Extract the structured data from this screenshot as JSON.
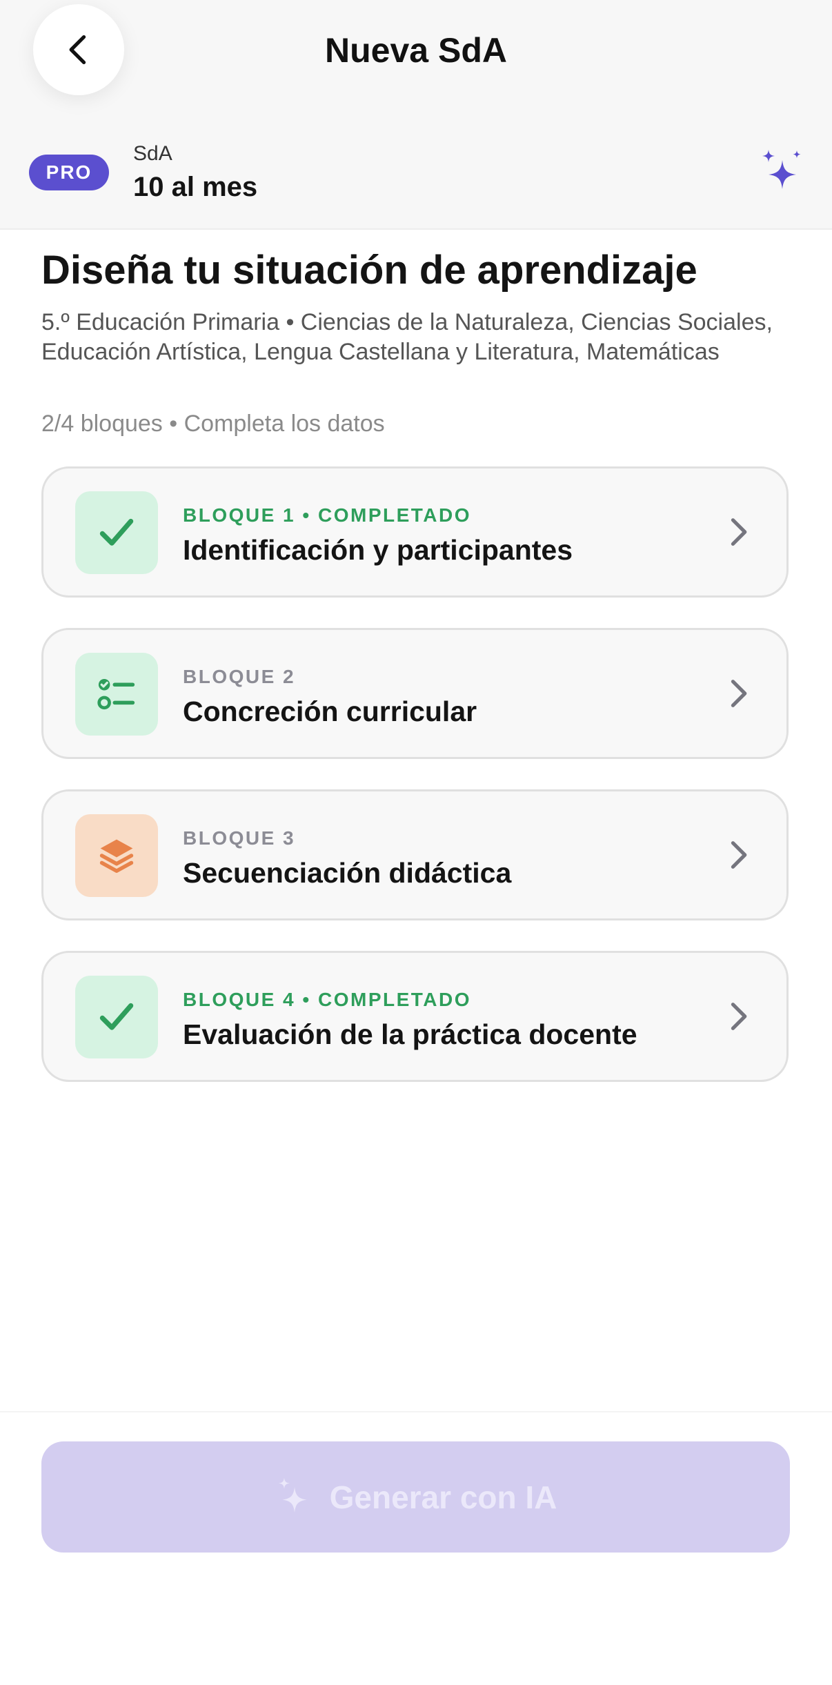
{
  "header": {
    "title": "Nueva SdA",
    "back_icon": "chevron-left-icon"
  },
  "plan": {
    "badge": "PRO",
    "label": "SdA",
    "value": "10 al mes",
    "sparkle_icon": "sparkles-icon"
  },
  "intro": {
    "title": "Diseña tu situación de aprendizaje",
    "subtitle": "5.º Educación Primaria • Ciencias de la Naturaleza, Ciencias Sociales, Educación Artística, Lengua Castellana y Literatura, Matemáticas",
    "progress": "2/4 bloques • Completa los datos"
  },
  "blocks": [
    {
      "eyebrow": "BLOQUE 1 • COMPLETADO",
      "title": "Identificación y participantes",
      "status": "completed",
      "icon": "check-icon"
    },
    {
      "eyebrow": "BLOQUE 2",
      "title": "Concreción curricular",
      "status": "pending",
      "icon": "checklist-icon"
    },
    {
      "eyebrow": "BLOQUE 3",
      "title": "Secuenciación didáctica",
      "status": "pending",
      "icon": "layers-icon"
    },
    {
      "eyebrow": "BLOQUE 4 • COMPLETADO",
      "title": "Evaluación de la práctica docente",
      "status": "completed",
      "icon": "check-icon"
    }
  ],
  "action": {
    "label": "Generar con IA",
    "icon": "sparkles-icon",
    "state": "disabled"
  },
  "colors": {
    "accent": "#5b4fcf",
    "success": "#2e9e5b",
    "success_bg": "#d6f3e2",
    "warning": "#e8834a",
    "warning_bg": "#f9dcc6",
    "button_disabled_bg": "#d3cdf0"
  }
}
